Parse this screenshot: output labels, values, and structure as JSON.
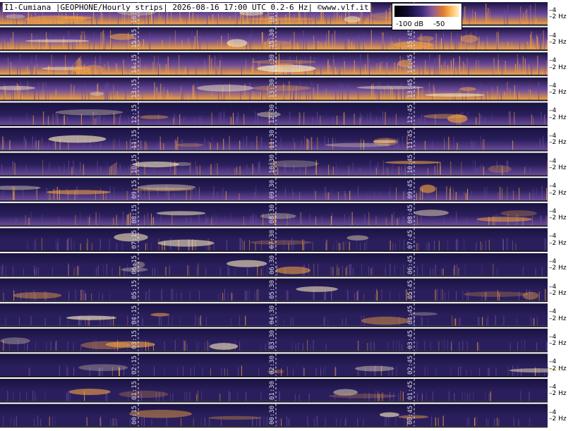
{
  "header": {
    "title": "I1-Cumiana |GEOPHONE/Hourly strips| 2026-08-16 17:00 UTC 0.2-6 Hz| ©www.vlf.it"
  },
  "legend": {
    "low_label": "-100 dB",
    "high_label": "-50"
  },
  "freq_ticks": [
    "4",
    "2 Hz"
  ],
  "strips": [
    {
      "hour": "16",
      "marks": [
        "16:15",
        "16:30",
        "16:45"
      ],
      "intensity": 0.95
    },
    {
      "hour": "15",
      "marks": [
        "15:15",
        "15:30",
        "15:45"
      ],
      "intensity": 0.85
    },
    {
      "hour": "14",
      "marks": [
        "14:15",
        "14:30",
        "14:45"
      ],
      "intensity": 0.9
    },
    {
      "hour": "13",
      "marks": [
        "13:15",
        "13:30",
        "13:45"
      ],
      "intensity": 0.75
    },
    {
      "hour": "12",
      "marks": [
        "12:15",
        "12:30",
        "12:45"
      ],
      "intensity": 0.45
    },
    {
      "hour": "11",
      "marks": [
        "11:15",
        "11:30",
        "11:45"
      ],
      "intensity": 0.5
    },
    {
      "hour": "10",
      "marks": [
        "10:15",
        "10:30",
        "10:45"
      ],
      "intensity": 0.55
    },
    {
      "hour": "09",
      "marks": [
        "09:15",
        "09:30",
        "09:45"
      ],
      "intensity": 0.5
    },
    {
      "hour": "08",
      "marks": [
        "08:15",
        "08:30",
        "08:45"
      ],
      "intensity": 0.45
    },
    {
      "hour": "07",
      "marks": [
        "07:15",
        "07:30",
        "07:45"
      ],
      "intensity": 0.4
    },
    {
      "hour": "06",
      "marks": [
        "06:15",
        "06:30",
        "06:45"
      ],
      "intensity": 0.35
    },
    {
      "hour": "05",
      "marks": [
        "05:15",
        "05:30",
        "05:45"
      ],
      "intensity": 0.35
    },
    {
      "hour": "04",
      "marks": [
        "04:15",
        "04:30",
        "04:45"
      ],
      "intensity": 0.25
    },
    {
      "hour": "03",
      "marks": [
        "03:15",
        "03:30",
        "03:45"
      ],
      "intensity": 0.3
    },
    {
      "hour": "02",
      "marks": [
        "02:15",
        "02:30",
        "02:45"
      ],
      "intensity": 0.25
    },
    {
      "hour": "01",
      "marks": [
        "01:15",
        "01:30",
        "01:45"
      ],
      "intensity": 0.25
    },
    {
      "hour": "00",
      "marks": [
        "00:15",
        "00:30",
        "00:45"
      ],
      "intensity": 0.25
    }
  ],
  "colors": {
    "background": "#2a1f5c",
    "low": "#1a1240",
    "mid": "#6a4a9a",
    "high": "#f0a040",
    "peak": "#fff0c0",
    "strip_separator": "#1c1c24",
    "gridline": "#ffffff"
  }
}
